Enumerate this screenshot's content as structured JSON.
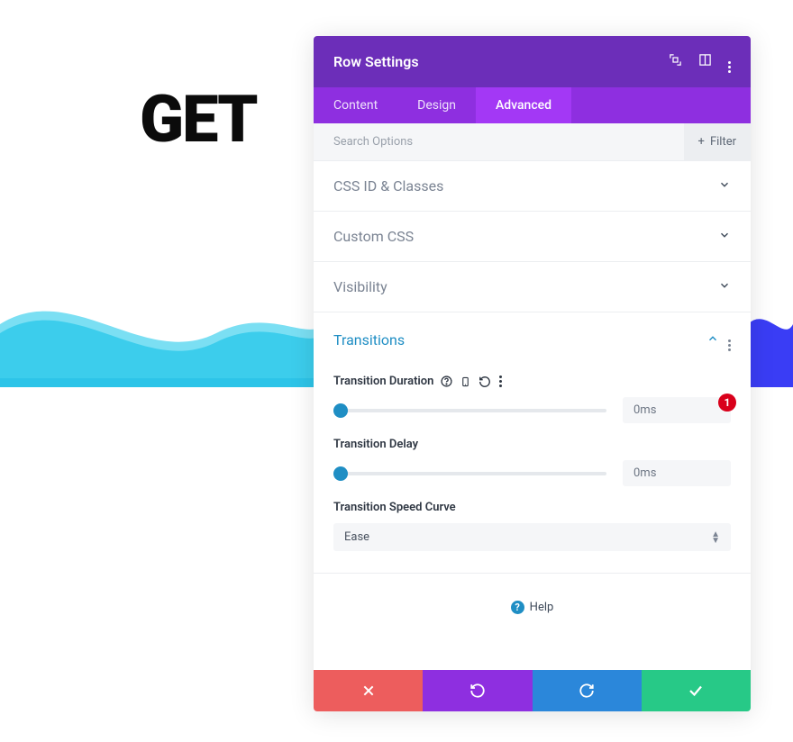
{
  "background_text": "GET",
  "panel": {
    "title": "Row Settings",
    "tabs": {
      "content": "Content",
      "design": "Design",
      "advanced": "Advanced",
      "active": "advanced"
    },
    "search": {
      "placeholder": "Search Options",
      "filter_label": "Filter"
    },
    "sections": {
      "css_id": "CSS ID & Classes",
      "custom_css": "Custom CSS",
      "visibility": "Visibility",
      "transitions": "Transitions"
    },
    "transitions": {
      "duration_label": "Transition Duration",
      "duration_value": "0ms",
      "delay_label": "Transition Delay",
      "delay_value": "0ms",
      "curve_label": "Transition Speed Curve",
      "curve_value": "Ease",
      "badge": "1"
    },
    "help_label": "Help"
  }
}
